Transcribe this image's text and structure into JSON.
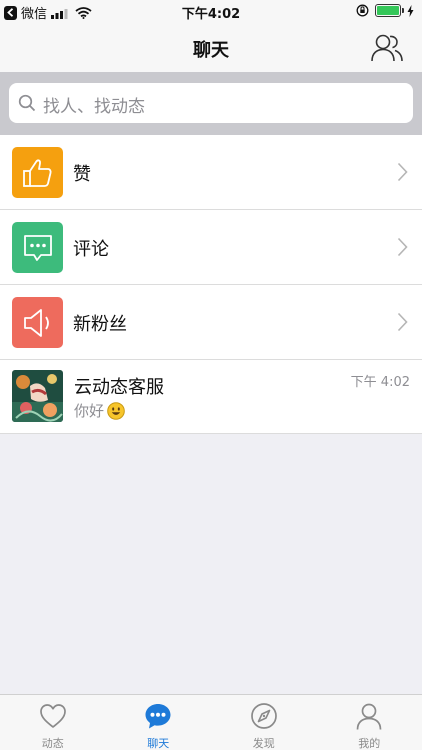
{
  "status_bar": {
    "app_name": "微信",
    "time": "下午4:02"
  },
  "nav": {
    "title": "聊天"
  },
  "search": {
    "placeholder": "找人、找动态"
  },
  "list": {
    "items": [
      {
        "label": "赞",
        "icon": "thumbs-up-icon",
        "color": "#f5a00f"
      },
      {
        "label": "评论",
        "icon": "comment-icon",
        "color": "#3dbb7c"
      },
      {
        "label": "新粉丝",
        "icon": "speaker-icon",
        "color": "#ee6b5d"
      }
    ],
    "chat": {
      "name": "云动态客服",
      "time": "下午 4:02",
      "message": "你好"
    }
  },
  "tab_bar": {
    "tabs": [
      {
        "label": "动态",
        "icon": "heart-icon",
        "active": false
      },
      {
        "label": "聊天",
        "icon": "chat-bubble-icon",
        "active": true
      },
      {
        "label": "发现",
        "icon": "compass-icon",
        "active": false
      },
      {
        "label": "我的",
        "icon": "person-icon",
        "active": false
      }
    ]
  },
  "colors": {
    "accent": "#1e7ad8",
    "battery": "#34c759"
  }
}
